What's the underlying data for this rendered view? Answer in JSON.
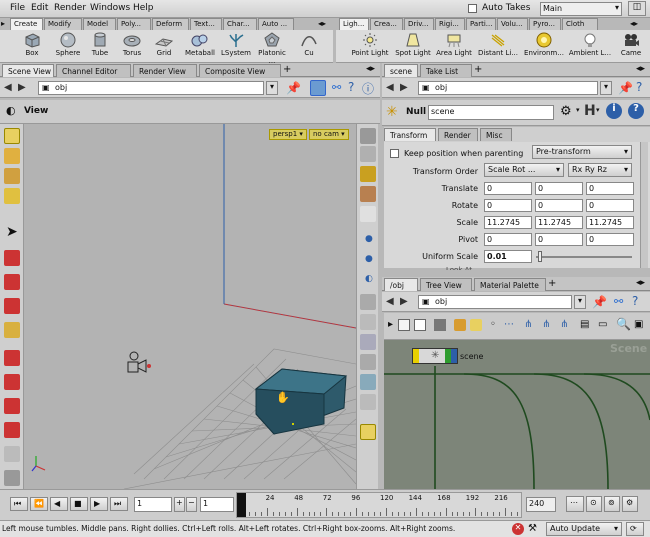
{
  "menubar": {
    "items": [
      "File",
      "Edit",
      "Render",
      "Windows",
      "Help"
    ],
    "auto_takes_label": "Auto Takes",
    "desktop_value": "Main"
  },
  "shelf_tabs_left": [
    "Create",
    "Modify",
    "Model",
    "Poly...",
    "Deform",
    "Text...",
    "Char...",
    "Auto ..."
  ],
  "shelf_tabs_right": [
    "Ligh...",
    "Crea...",
    "Driv...",
    "Rigi...",
    "Parti...",
    "Volu...",
    "Pyro...",
    "Cloth"
  ],
  "shelf_tools_left": [
    "Box",
    "Sphere",
    "Tube",
    "Torus",
    "Grid",
    "Metaball",
    "LSystem",
    "Platonic ...",
    "Cu"
  ],
  "shelf_tools_right": [
    "Point Light",
    "Spot Light",
    "Area Light",
    "Distant Li...",
    "Environm...",
    "Ambient L...",
    "Came"
  ],
  "scene_panel": {
    "tabs": [
      "Scene View",
      "Channel Editor",
      "Render View",
      "Composite View"
    ],
    "path": "obj",
    "view_label": "View",
    "camera_menu": "persp1",
    "nocam_menu": "no cam"
  },
  "param_panel": {
    "tabs": [
      "scene",
      "Take List"
    ],
    "path": "obj",
    "node_type": "Null",
    "node_name": "scene",
    "subtabs": [
      "Transform",
      "Render",
      "Misc"
    ],
    "keep_position_label": "Keep position when parenting",
    "keep_position_menu": "Pre-transform",
    "transform_order_label": "Transform Order",
    "transform_order_value": "Scale Rot ...",
    "rotate_order_value": "Rx Ry Rz",
    "rows": [
      {
        "label": "Translate",
        "values": [
          "0",
          "0",
          "0"
        ]
      },
      {
        "label": "Rotate",
        "values": [
          "0",
          "0",
          "0"
        ]
      },
      {
        "label": "Scale",
        "values": [
          "11.2745",
          "11.2745",
          "11.2745"
        ]
      },
      {
        "label": "Pivot",
        "values": [
          "0",
          "0",
          "0"
        ]
      }
    ],
    "uniform_scale_label": "Uniform Scale",
    "uniform_scale_value": "0.01",
    "uniform_scale_fraction": 0.02,
    "look_at_label": "Look At"
  },
  "network_panel": {
    "tabs": [
      "/obj",
      "Tree View",
      "Material Palette"
    ],
    "path": "obj",
    "node_label": "scene",
    "watermark": "Scene"
  },
  "timeline": {
    "start_frame": "1",
    "current_frame": "1",
    "end_frame": "240",
    "ticks": [
      "1",
      "24",
      "48",
      "72",
      "96",
      "120",
      "144",
      "168",
      "192",
      "216"
    ],
    "playhead_fraction": 0.0
  },
  "statusbar": {
    "message": "Left mouse tumbles. Middle pans. Right dollies. Ctrl+Left rolls. Alt+Left rotates. Ctrl+Right box-zooms. Alt+Right zooms.",
    "update_mode": "Auto Update"
  },
  "colors": {
    "accent_blue": "#2d5fa8",
    "node_bar_yellow": "#e8d000",
    "node_bar_green": "#2e9c2e",
    "network_bg": "#7d8579",
    "box_teal": "#2e5a6b"
  }
}
